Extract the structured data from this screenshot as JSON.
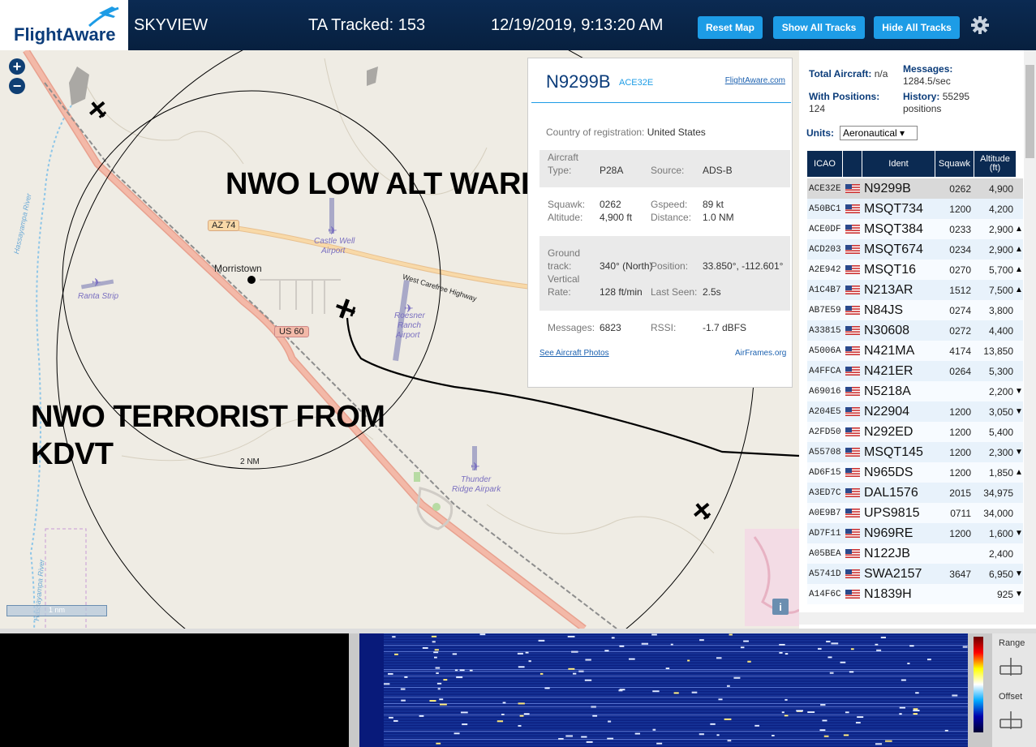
{
  "header": {
    "logo_text": "FlightAware",
    "app_name": "SKYVIEW",
    "tracked": "TA Tracked: 153",
    "datetime": "12/19/2019, 9:13:20 AM",
    "buttons": {
      "reset": "Reset Map",
      "show": "Show All Tracks",
      "hide": "Hide All Tracks"
    },
    "gear_icon": "gear-icon"
  },
  "map": {
    "zoom_in": "+",
    "zoom_out": "−",
    "labels": {
      "morristown": "Morristown",
      "az74": "AZ 74",
      "us60": "US 60",
      "castle_well": "Castle Well",
      "castle_well2": "Airport",
      "highway": "West Carefree Highway",
      "ranta": "Ranta Strip",
      "roesner1": "Roesner",
      "roesner2": "Ranch",
      "roesner3": "Airport",
      "thunder1": "Thunder",
      "thunder2": "Ridge Airpark",
      "range_ring": "2 NM",
      "scale": "1 nm",
      "river1": "Hassayampa River",
      "river2": "Hassayampa River"
    },
    "overlay_text": {
      "warrior": "NWO LOW ALT WARRIOR",
      "terrorist1": "NWO TERRORIST FROM",
      "terrorist2": "KDVT"
    },
    "info_button": "i"
  },
  "infobox": {
    "ident": "N9299B",
    "icao": "ACE32E",
    "fa_link": "FlightAware.com",
    "country_label": "Country of registration:",
    "country": "United States",
    "aircraft_type_label1": "Aircraft",
    "aircraft_type_label2": "Type:",
    "aircraft_type": "P28A",
    "source_label": "Source:",
    "source": "ADS-B",
    "squawk_label": "Squawk:",
    "squawk": "0262",
    "gspeed_label": "Gspeed:",
    "gspeed": "89 kt",
    "altitude_label": "Altitude:",
    "altitude": "4,900 ft",
    "distance_label": "Distance:",
    "distance": "1.0 NM",
    "ground_label1": "Ground",
    "ground_label2": "track:",
    "ground_track": "340° (North)",
    "position_label": "Position:",
    "position": "33.850°, -112.601°",
    "vrate_label1": "Vertical",
    "vrate_label2": "Rate:",
    "vrate": "128 ft/min",
    "lastseen_label": "Last Seen:",
    "lastseen": "2.5s",
    "messages_label": "Messages:",
    "messages": "6823",
    "rssi_label": "RSSI:",
    "rssi": "-1.7 dBFS",
    "photos_link": "See Aircraft Photos",
    "airframes_link": "AirFrames.org"
  },
  "panel": {
    "total_label": "Total Aircraft:",
    "total": "n/a",
    "messages_label": "Messages:",
    "messages": "1284.5/sec",
    "positions_label": "With Positions:",
    "positions": "124",
    "history_label": "History:",
    "history": "55295",
    "history_unit": "positions",
    "units_label": "Units:",
    "units_value": "Aeronautical ▾",
    "columns": {
      "icao": "ICAO",
      "ident": "Ident",
      "squawk": "Squawk",
      "alt1": "Altitude",
      "alt2": "(ft)"
    },
    "rows": [
      {
        "icao": "ACE32E",
        "ident": "N9299B",
        "squawk": "0262",
        "alt": "4,900",
        "arrow": ""
      },
      {
        "icao": "A50BC1",
        "ident": "MSQT734",
        "squawk": "1200",
        "alt": "4,200",
        "arrow": ""
      },
      {
        "icao": "ACE0DF",
        "ident": "MSQT384",
        "squawk": "0233",
        "alt": "2,900",
        "arrow": "▲"
      },
      {
        "icao": "ACD203",
        "ident": "MSQT674",
        "squawk": "0234",
        "alt": "2,900",
        "arrow": "▲"
      },
      {
        "icao": "A2E942",
        "ident": "MSQT16",
        "squawk": "0270",
        "alt": "5,700",
        "arrow": "▲"
      },
      {
        "icao": "A1C4B7",
        "ident": "N213AR",
        "squawk": "1512",
        "alt": "7,500",
        "arrow": "▲"
      },
      {
        "icao": "AB7E59",
        "ident": "N84JS",
        "squawk": "0274",
        "alt": "3,800",
        "arrow": ""
      },
      {
        "icao": "A33815",
        "ident": "N30608",
        "squawk": "0272",
        "alt": "4,400",
        "arrow": ""
      },
      {
        "icao": "A5006A",
        "ident": "N421MA",
        "squawk": "4174",
        "alt": "13,850",
        "arrow": ""
      },
      {
        "icao": "A4FFCA",
        "ident": "N421ER",
        "squawk": "0264",
        "alt": "5,300",
        "arrow": ""
      },
      {
        "icao": "A69016",
        "ident": "N5218A",
        "squawk": "",
        "alt": "2,200",
        "arrow": "▼"
      },
      {
        "icao": "A204E5",
        "ident": "N22904",
        "squawk": "1200",
        "alt": "3,050",
        "arrow": "▼"
      },
      {
        "icao": "A2FD50",
        "ident": "N292ED",
        "squawk": "1200",
        "alt": "5,400",
        "arrow": ""
      },
      {
        "icao": "A55708",
        "ident": "MSQT145",
        "squawk": "1200",
        "alt": "2,300",
        "arrow": "▼"
      },
      {
        "icao": "AD6F15",
        "ident": "N965DS",
        "squawk": "1200",
        "alt": "1,850",
        "arrow": "▲"
      },
      {
        "icao": "A3ED7C",
        "ident": "DAL1576",
        "squawk": "2015",
        "alt": "34,975",
        "arrow": ""
      },
      {
        "icao": "A0E9B7",
        "ident": "UPS9815",
        "squawk": "0711",
        "alt": "34,000",
        "arrow": ""
      },
      {
        "icao": "AD7F11",
        "ident": "N969RE",
        "squawk": "1200",
        "alt": "1,600",
        "arrow": "▼"
      },
      {
        "icao": "A05BEA",
        "ident": "N122JB",
        "squawk": "",
        "alt": "2,400",
        "arrow": ""
      },
      {
        "icao": "A5741D",
        "ident": "SWA2157",
        "squawk": "3647",
        "alt": "6,950",
        "arrow": "▼"
      },
      {
        "icao": "A14F6C",
        "ident": "N1839H",
        "squawk": "",
        "alt": "925",
        "arrow": "▼"
      }
    ]
  },
  "bottom": {
    "range_label": "Range",
    "offset_label": "Offset"
  },
  "colors": {
    "header": "#0b2a52",
    "button": "#1d9ce6",
    "selected_row": "#d9d9d9",
    "row_alt": "#e8f2fb"
  }
}
